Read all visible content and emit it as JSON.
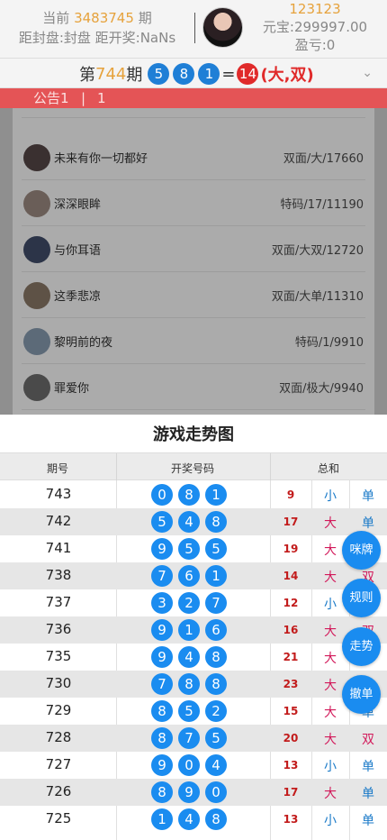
{
  "header": {
    "current_prefix": "当前",
    "current_issue": "3483745",
    "current_suffix": "期",
    "countdown_line": "距封盘:封盘 距开奖:NaNs",
    "user_id": "123123",
    "balance": "元宝:299997.00",
    "profit": "盈亏:0"
  },
  "result_bar": {
    "prefix": "第",
    "issue": "744",
    "suffix": "期",
    "balls": [
      "5",
      "8",
      "1"
    ],
    "equals": "=",
    "sum": "14",
    "tag": "(大,双)"
  },
  "notice": {
    "label": "公告1",
    "sep": "|",
    "text": "1"
  },
  "bets": [
    {
      "name": "未来有你一切都好",
      "bet": "双面/大/17660",
      "avatar": "#3a3030"
    },
    {
      "name": "深深眼眸",
      "bet": "特码/17/11190",
      "avatar": "#6a5e58"
    },
    {
      "name": "与你耳语",
      "bet": "双面/大双/12720",
      "avatar": "#2c3448"
    },
    {
      "name": "这季悲凉",
      "bet": "双面/大单/11310",
      "avatar": "#5e5246"
    },
    {
      "name": "黎明前的夜",
      "bet": "特码/1/9910",
      "avatar": "#5c6a78"
    },
    {
      "name": "罪爱你",
      "bet": "双面/极大/9940",
      "avatar": "#4a4a4a"
    }
  ],
  "sheet": {
    "title": "游戏走势图",
    "col_issue": "期号",
    "col_numbers": "开奖号码",
    "col_sum": "总和"
  },
  "rows": [
    {
      "issue": "743",
      "n": [
        "0",
        "8",
        "1"
      ],
      "sum": "9",
      "size": "小",
      "parity": "单"
    },
    {
      "issue": "742",
      "n": [
        "5",
        "4",
        "8"
      ],
      "sum": "17",
      "size": "大",
      "parity": "单"
    },
    {
      "issue": "741",
      "n": [
        "9",
        "5",
        "5"
      ],
      "sum": "19",
      "size": "大",
      "parity": "单"
    },
    {
      "issue": "738",
      "n": [
        "7",
        "6",
        "1"
      ],
      "sum": "14",
      "size": "大",
      "parity": "双"
    },
    {
      "issue": "737",
      "n": [
        "3",
        "2",
        "7"
      ],
      "sum": "12",
      "size": "小",
      "parity": "双"
    },
    {
      "issue": "736",
      "n": [
        "9",
        "1",
        "6"
      ],
      "sum": "16",
      "size": "大",
      "parity": "双"
    },
    {
      "issue": "735",
      "n": [
        "9",
        "4",
        "8"
      ],
      "sum": "21",
      "size": "大",
      "parity": "单"
    },
    {
      "issue": "730",
      "n": [
        "7",
        "8",
        "8"
      ],
      "sum": "23",
      "size": "大",
      "parity": "单"
    },
    {
      "issue": "729",
      "n": [
        "8",
        "5",
        "2"
      ],
      "sum": "15",
      "size": "大",
      "parity": "单"
    },
    {
      "issue": "728",
      "n": [
        "8",
        "7",
        "5"
      ],
      "sum": "20",
      "size": "大",
      "parity": "双"
    },
    {
      "issue": "727",
      "n": [
        "9",
        "0",
        "4"
      ],
      "sum": "13",
      "size": "小",
      "parity": "单"
    },
    {
      "issue": "726",
      "n": [
        "8",
        "9",
        "0"
      ],
      "sum": "17",
      "size": "大",
      "parity": "单"
    },
    {
      "issue": "725",
      "n": [
        "1",
        "4",
        "8"
      ],
      "sum": "13",
      "size": "小",
      "parity": "单"
    }
  ],
  "fabs": [
    "咪牌",
    "规则",
    "走势",
    "撤单"
  ]
}
